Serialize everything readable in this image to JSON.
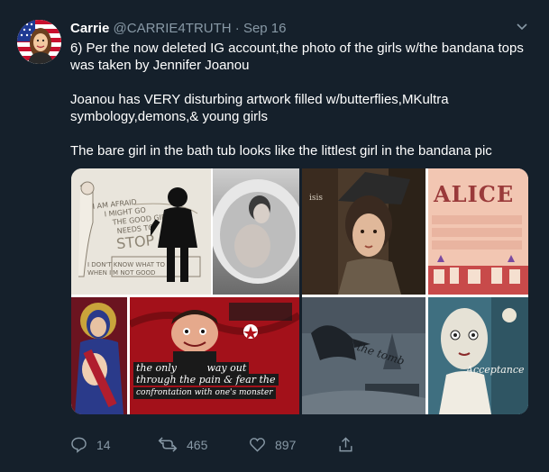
{
  "tweet": {
    "author_name": "Carrie",
    "handle": "@CARRIE4TRUTH",
    "separator": "·",
    "date": "Sep 16",
    "paragraphs": [
      "6) Per the now deleted IG account,the photo of the girls w/the bandana tops was taken by Jennifer Joanou",
      "Joanou has VERY disturbing artwork filled w/butterflies,MKultra symbology,demons,& young girls",
      "The bare girl in the bath tub looks like the littlest girl in the bandana pic"
    ]
  },
  "media": {
    "left": {
      "sketch_text": [
        "I AM AFRAID",
        "I MIGHT GO",
        "THE GOOD GIRL",
        "NEEDS TO",
        "STOP",
        "I DON'T KNOW WHAT TO",
        "WHEN I'M NOT GOOD"
      ],
      "banner_text": [
        "the only",
        "way out",
        "through the pain & fear the",
        "confrontation with one's monster"
      ]
    },
    "right": {
      "alice_title": "ALICE",
      "poster_text": "isis",
      "bottom_text": "the tomb",
      "accept_text": "Acceptance"
    }
  },
  "actions": {
    "reply": {
      "icon": "reply-icon",
      "count": "14"
    },
    "retweet": {
      "icon": "retweet-icon",
      "count": "465"
    },
    "like": {
      "icon": "like-icon",
      "count": "897"
    },
    "share": {
      "icon": "share-icon"
    }
  },
  "colors": {
    "background": "#15202b",
    "secondary_text": "#8899a6",
    "text": "#ffffff"
  }
}
